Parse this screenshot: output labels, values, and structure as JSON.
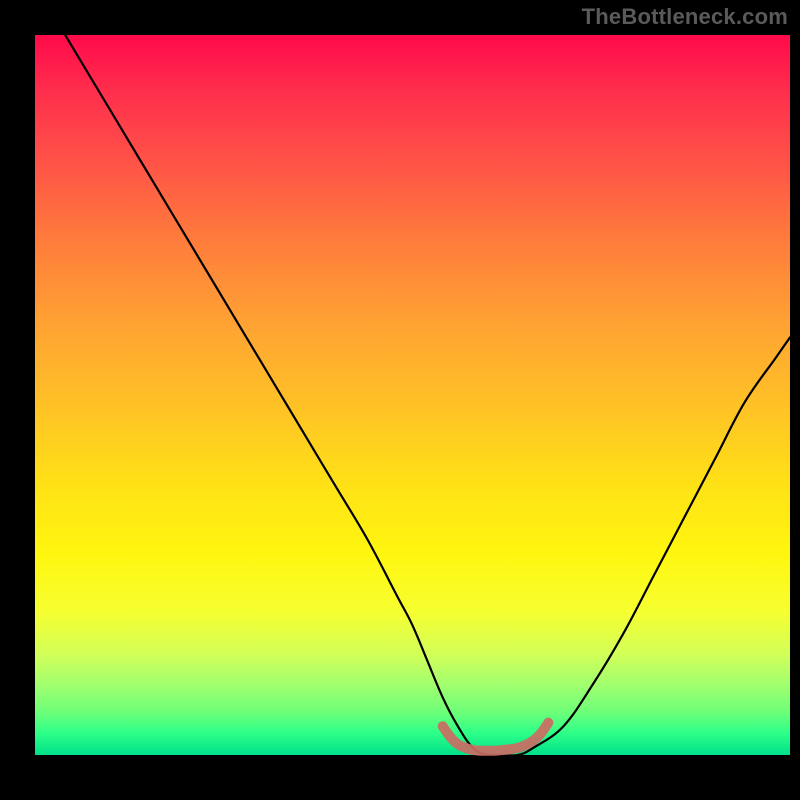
{
  "watermark": "TheBottleneck.com",
  "chart_data": {
    "type": "line",
    "title": "",
    "xlabel": "",
    "ylabel": "",
    "xlim": [
      0,
      100
    ],
    "ylim": [
      0,
      100
    ],
    "grid": false,
    "series": [
      {
        "name": "bottleneck-curve",
        "color": "#000000",
        "x": [
          4,
          8,
          12,
          16,
          20,
          24,
          28,
          32,
          36,
          40,
          44,
          48,
          50,
          52,
          54,
          56,
          58,
          60,
          62,
          64,
          66,
          70,
          74,
          78,
          82,
          86,
          90,
          94,
          98,
          100
        ],
        "y": [
          100,
          93,
          86,
          79,
          72,
          65,
          58,
          51,
          44,
          37,
          30,
          22,
          18,
          13,
          8,
          4,
          1,
          0,
          0,
          0,
          1,
          4,
          10,
          17,
          25,
          33,
          41,
          49,
          55,
          58
        ]
      },
      {
        "name": "valley-marker",
        "color": "#cc6b63",
        "x": [
          54,
          55,
          56,
          57,
          58,
          59,
          60,
          61,
          62,
          63,
          64,
          65,
          66,
          67,
          68
        ],
        "y": [
          4,
          2.5,
          1.5,
          1,
          0.7,
          0.6,
          0.6,
          0.6,
          0.7,
          0.8,
          1,
          1.4,
          2,
          3,
          4.5
        ]
      }
    ],
    "background_gradient": {
      "top": "#ff0a4a",
      "upper_mid": "#ffa233",
      "mid": "#ffe017",
      "lower_mid": "#d2ff58",
      "bottom": "#00e08a"
    }
  }
}
